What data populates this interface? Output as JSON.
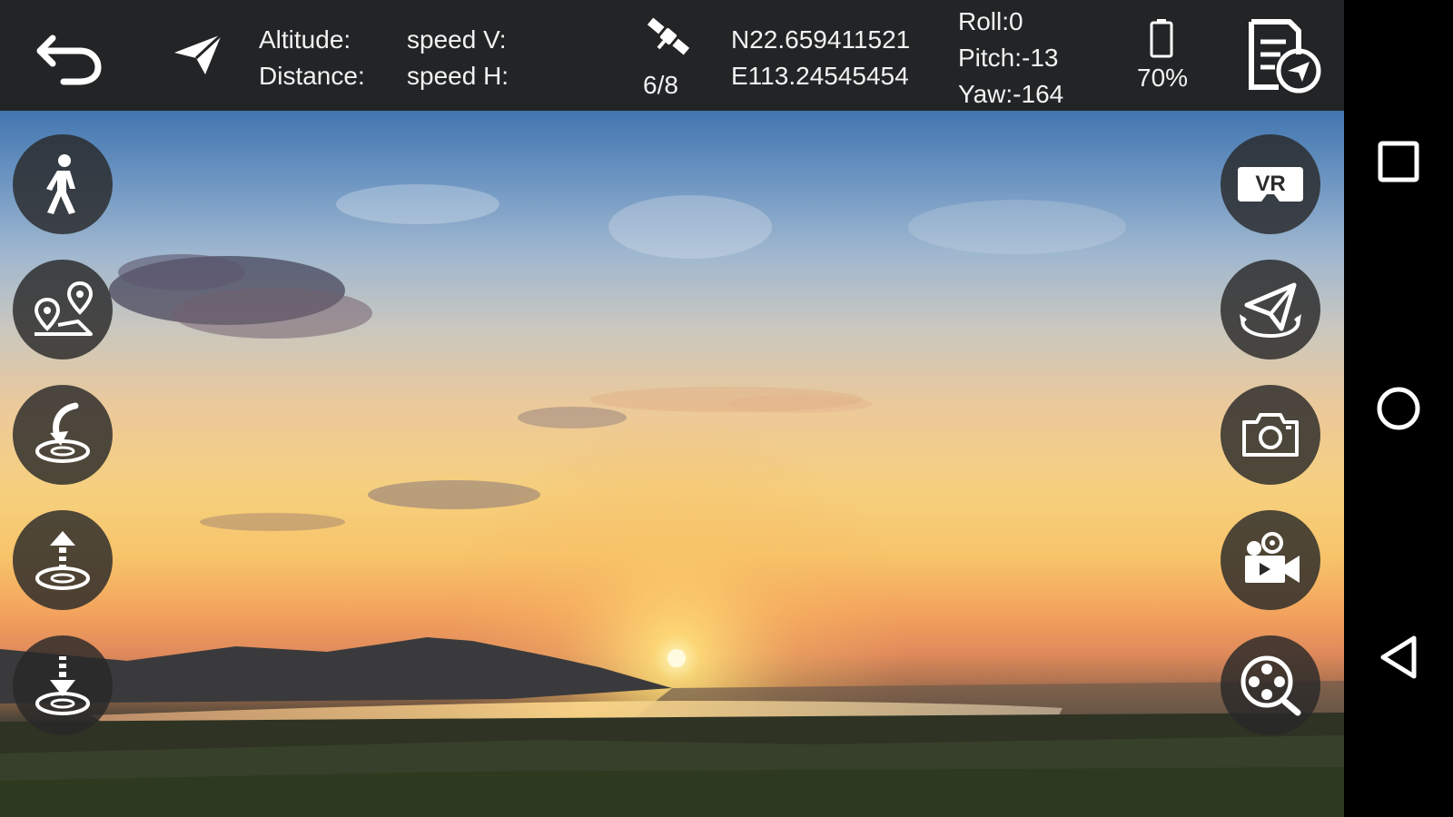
{
  "telemetry": {
    "altitude_label": "Altitude:",
    "distance_label": "Distance:",
    "speed_v_label": "speed V:",
    "speed_h_label": "speed H:",
    "satellites": "6/8",
    "latitude": "N22.659411521",
    "longitude": "E113.24545454",
    "roll": "Roll:0",
    "pitch": "Pitch:-13",
    "yaw": "Yaw:-164",
    "battery": "70%"
  },
  "icons": {
    "back": "back-arrow-icon",
    "flight_mode": "paper-plane-icon",
    "gps": "satellite-icon",
    "battery": "battery-icon",
    "flight_log": "flight-log-icon"
  },
  "left_controls": [
    "follow-me",
    "waypoint-route",
    "one-key-return",
    "one-key-takeoff",
    "one-key-landing"
  ],
  "right_controls": [
    "vr-mode",
    "orbit-flight",
    "take-photo",
    "record-video",
    "media-gallery"
  ],
  "vr_label": "VR",
  "navigation": [
    "recents",
    "home",
    "back"
  ]
}
